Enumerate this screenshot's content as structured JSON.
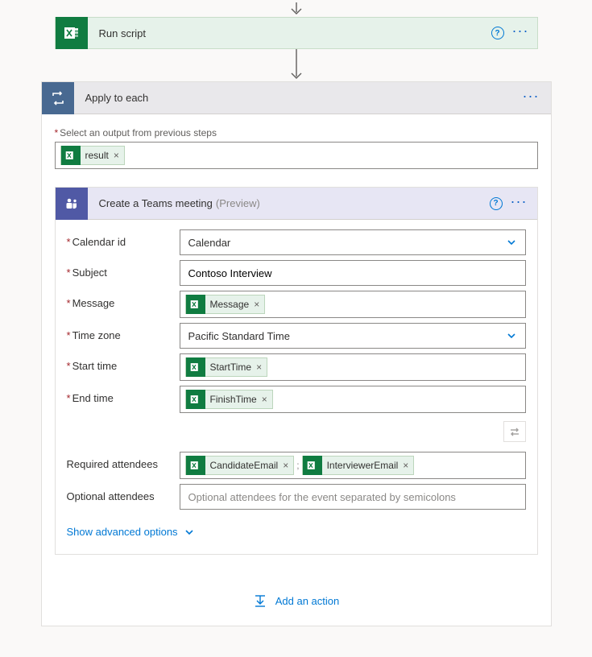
{
  "runscript": {
    "title": "Run script"
  },
  "apply": {
    "title": "Apply to each",
    "output_label": "Select an output from previous steps",
    "output_token": "result"
  },
  "teams": {
    "title": "Create a Teams meeting",
    "preview": "(Preview)",
    "fields": {
      "calendar_label": "Calendar id",
      "calendar_value": "Calendar",
      "subject_label": "Subject",
      "subject_value": "Contoso Interview",
      "message_label": "Message",
      "message_token": "Message",
      "timezone_label": "Time zone",
      "timezone_value": "Pacific Standard Time",
      "start_label": "Start time",
      "start_token": "StartTime",
      "end_label": "End time",
      "end_token": "FinishTime",
      "required_label": "Required attendees",
      "required_token1": "CandidateEmail",
      "required_token2": "InterviewerEmail",
      "optional_label": "Optional attendees",
      "optional_placeholder": "Optional attendees for the event separated by semicolons"
    },
    "advanced": "Show advanced options"
  },
  "add_action": "Add an action"
}
